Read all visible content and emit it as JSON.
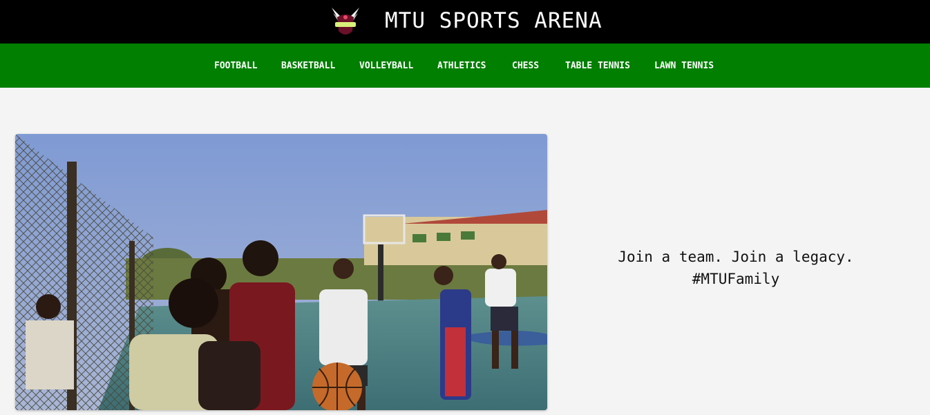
{
  "header": {
    "title": "MTU SPORTS ARENA",
    "logo_icon": "winged-crest-logo"
  },
  "nav": {
    "items": [
      {
        "label": "FOOTBALL"
      },
      {
        "label": "BASKETBALL"
      },
      {
        "label": "VOLLEYBALL"
      },
      {
        "label": "ATHLETICS"
      },
      {
        "label": "CHESS"
      },
      {
        "label": "TABLE TENNIS"
      },
      {
        "label": "LAWN TENNIS"
      }
    ]
  },
  "hero": {
    "tagline_line1": "Join a team. Join a legacy.",
    "tagline_line2": "#MTUFamily"
  },
  "colors": {
    "topbar": "#000000",
    "navbar": "#007f00",
    "page_bg": "#f4f4f4"
  }
}
